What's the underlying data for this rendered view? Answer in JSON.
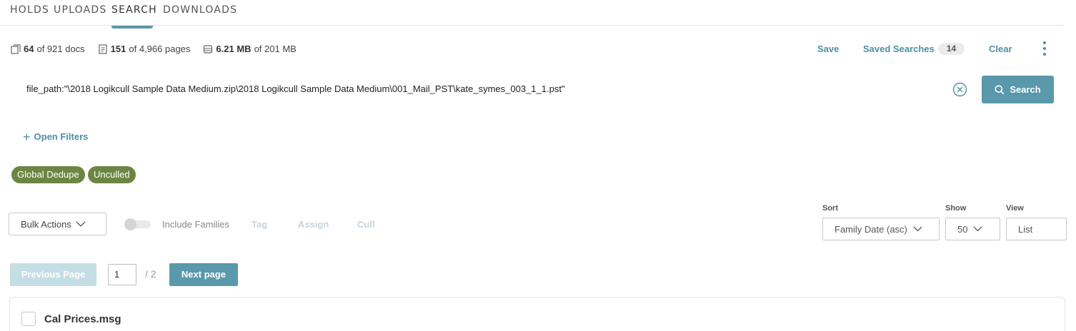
{
  "tabs": [
    {
      "label": "HOLDS"
    },
    {
      "label": "UPLOADS"
    },
    {
      "label": "SEARCH",
      "active": true
    },
    {
      "label": "DOWNLOADS"
    }
  ],
  "stats": {
    "docs_count": "64",
    "docs_rest": "of 921 docs",
    "pages_count": "151",
    "pages_rest": "of 4,966 pages",
    "size_count": "6.21 MB",
    "size_rest": "of 201 MB"
  },
  "actions": {
    "save": "Save",
    "saved_searches": "Saved Searches",
    "saved_searches_count": "14",
    "clear": "Clear"
  },
  "search": {
    "query": "file_path:\"\\2018 Logikcull Sample Data Medium.zip\\2018 Logikcull Sample Data Medium\\001_Mail_PST\\kate_symes_003_1_1.pst\"",
    "button": "Search"
  },
  "filters": {
    "open_filters": "Open Filters",
    "chips": [
      "Global Dedupe",
      "Unculled"
    ]
  },
  "toolbar": {
    "bulk_actions": "Bulk Actions",
    "include_families": "Include Families",
    "include_families_on": false,
    "tag": "Tag",
    "assign": "Assign",
    "cull": "Cull"
  },
  "controls": {
    "sort_label": "Sort",
    "sort_value": "Family Date (asc)",
    "show_label": "Show",
    "show_value": "50",
    "view_label": "View",
    "view_value": "List"
  },
  "pagination": {
    "previous": "Previous Page",
    "current_page": "1",
    "total": "/ 2",
    "next": "Next page"
  },
  "results": [
    {
      "name": "Cal Prices.msg"
    }
  ],
  "colors": {
    "accent": "#5a98ab",
    "link": "#4c8fa3",
    "chip": "#6b8642",
    "disabled": "#c5dde5"
  }
}
